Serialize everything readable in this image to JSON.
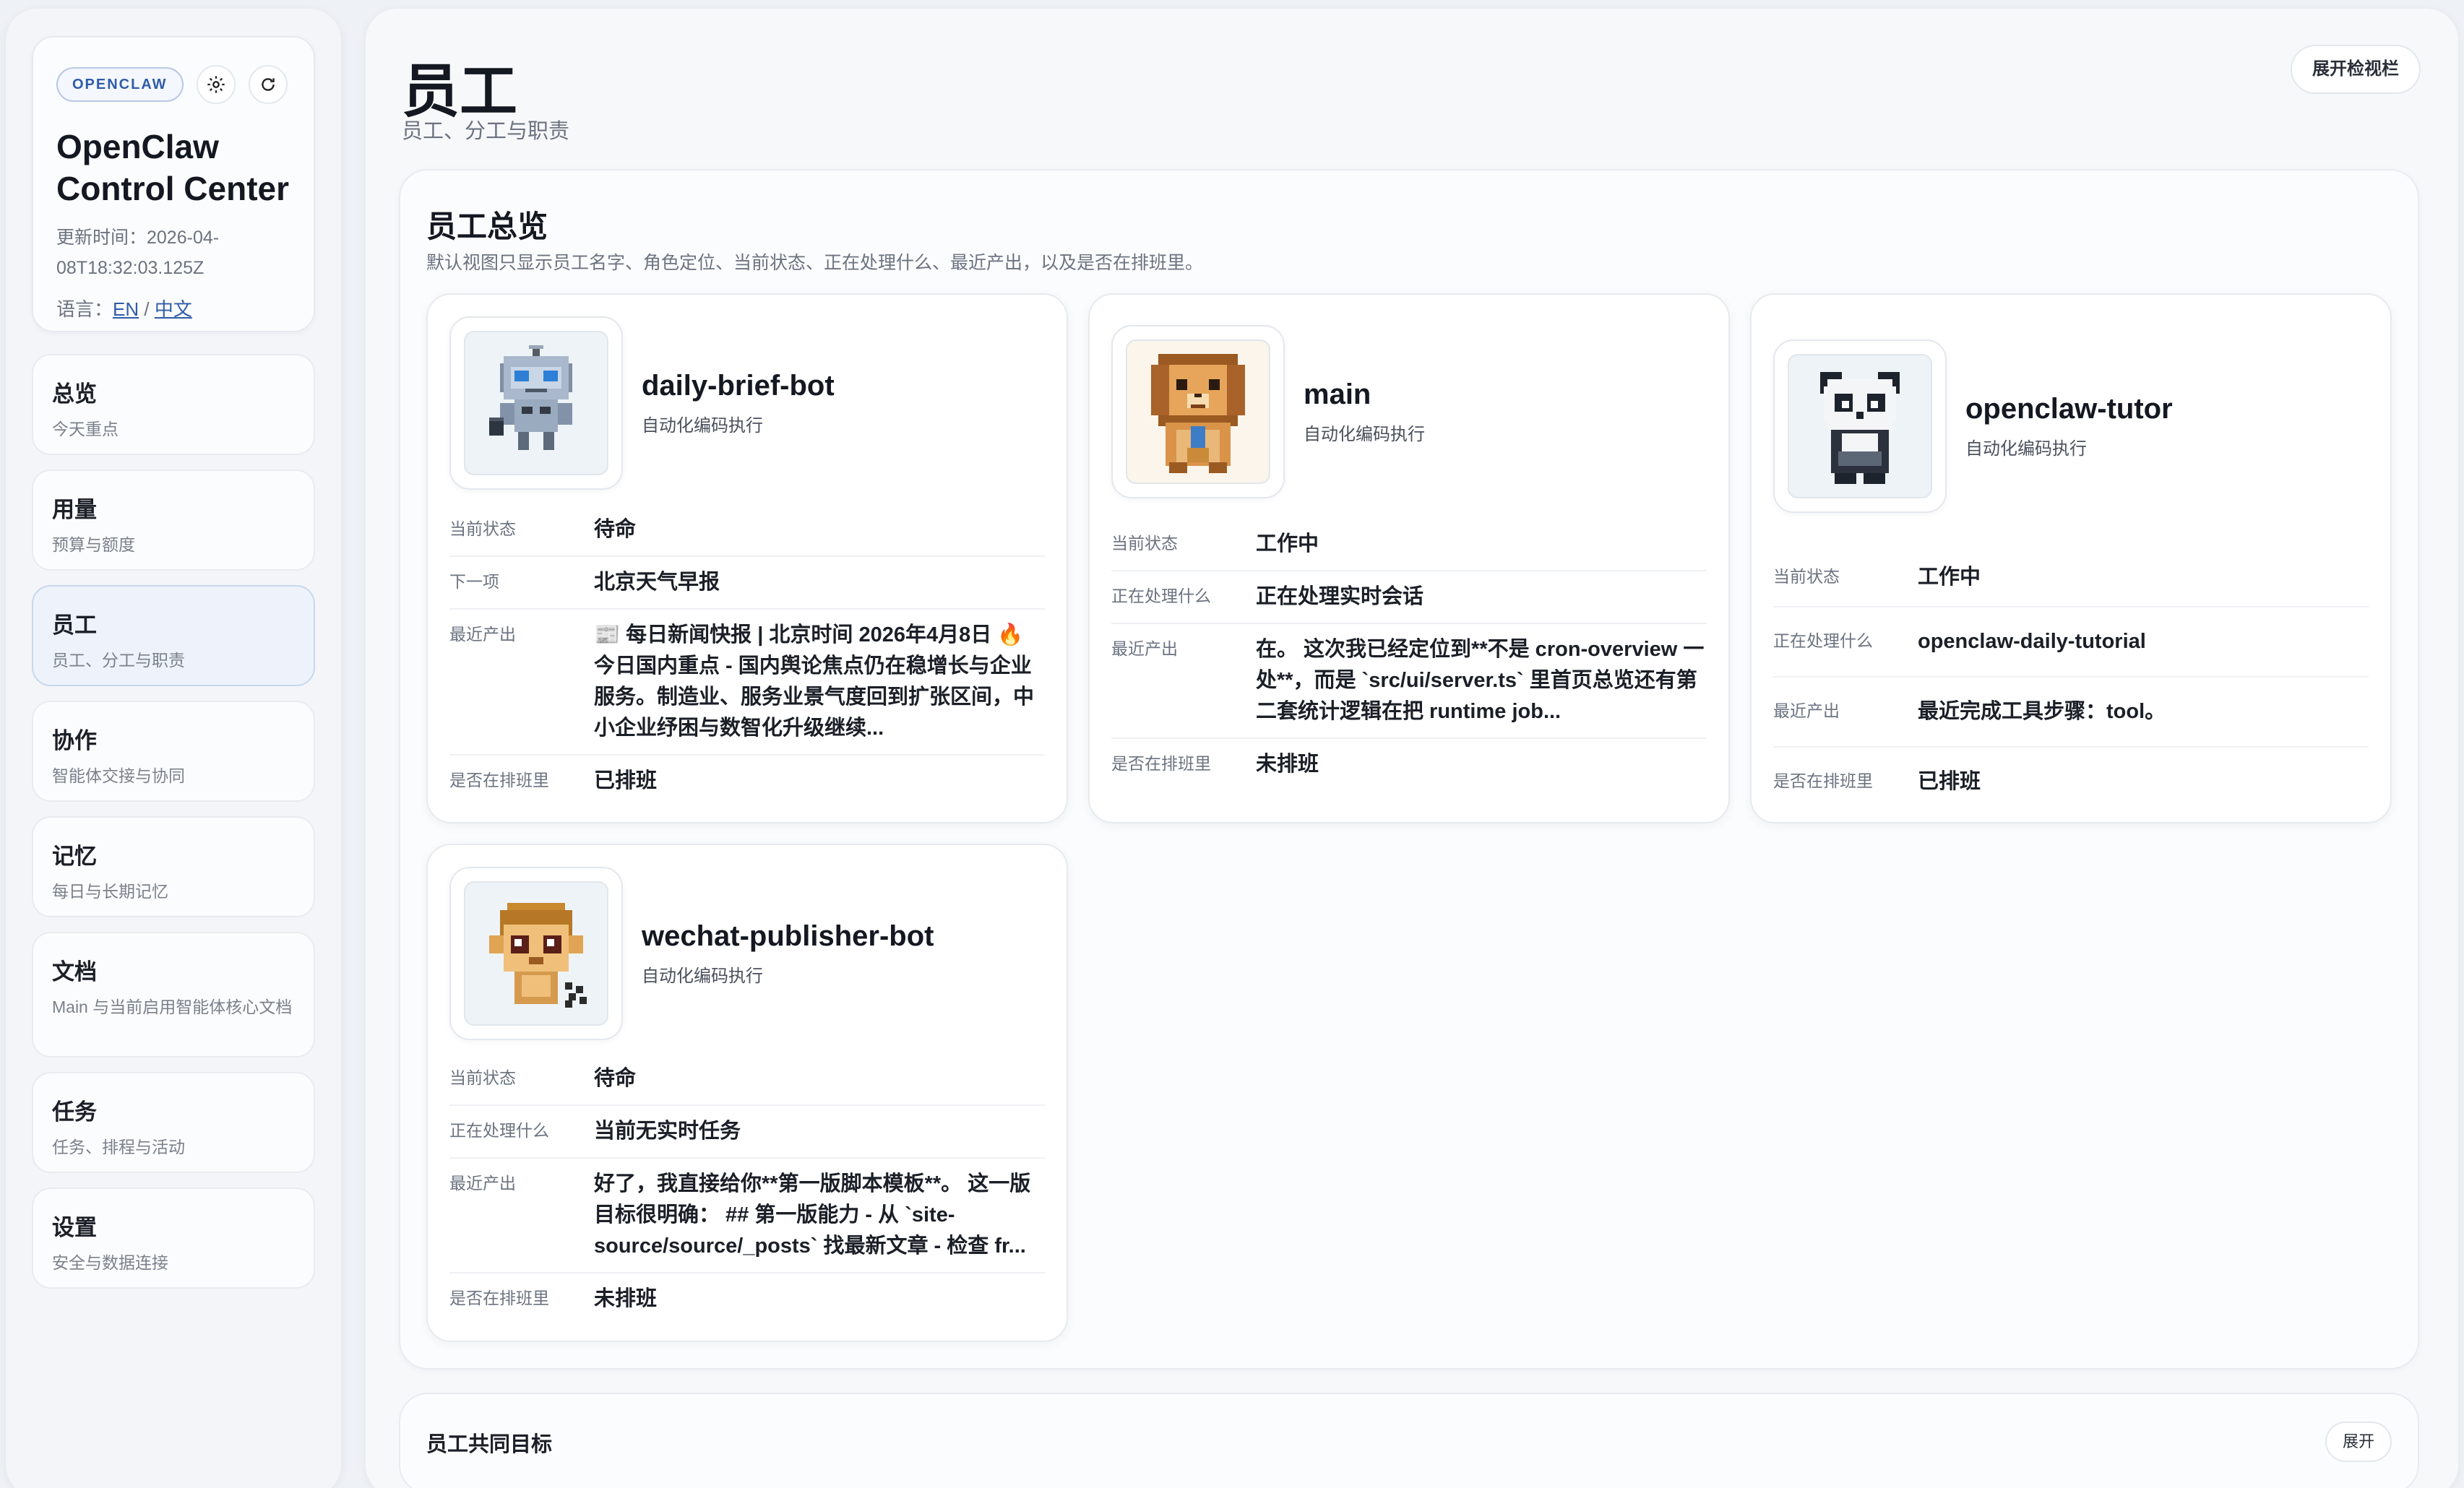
{
  "sidebar": {
    "badge": "OPENCLAW",
    "title": "OpenClaw Control Center",
    "updated": "更新时间：2026-04-08T18:32:03.125Z",
    "lang_label": "语言：",
    "lang_en": "EN",
    "lang_sep": " / ",
    "lang_zh": "中文",
    "items": [
      {
        "label": "总览",
        "sub": "今天重点"
      },
      {
        "label": "用量",
        "sub": "预算与额度"
      },
      {
        "label": "员工",
        "sub": "员工、分工与职责"
      },
      {
        "label": "协作",
        "sub": "智能体交接与协同"
      },
      {
        "label": "记忆",
        "sub": "每日与长期记忆"
      },
      {
        "label": "文档",
        "sub": "Main 与当前启用智能体核心文档"
      },
      {
        "label": "任务",
        "sub": "任务、排程与活动"
      },
      {
        "label": "设置",
        "sub": "安全与数据连接"
      }
    ]
  },
  "header": {
    "title": "员工",
    "subtitle": "员工、分工与职责",
    "inspector_button": "展开检视栏"
  },
  "overview": {
    "title": "员工总览",
    "desc": "默认视图只显示员工名字、角色定位、当前状态、正在处理什么、最近产出，以及是否在排班里。"
  },
  "agents": [
    {
      "name": "daily-brief-bot",
      "role": "自动化编码执行",
      "rows": [
        {
          "label": "当前状态",
          "value": "待命"
        },
        {
          "label": "下一项",
          "value": "北京天气早报"
        },
        {
          "label": "最近产出",
          "value": "📰 每日新闻快报 | 北京时间 2026年4月8日 🔥 今日国内重点 - 国内舆论焦点仍在稳增长与企业服务。制造业、服务业景气度回到扩张区间，中小企业纾困与数智化升级继续..."
        },
        {
          "label": "是否在排班里",
          "value": "已排班"
        }
      ]
    },
    {
      "name": "main",
      "role": "自动化编码执行",
      "rows": [
        {
          "label": "当前状态",
          "value": "工作中"
        },
        {
          "label": "正在处理什么",
          "value": "正在处理实时会话"
        },
        {
          "label": "最近产出",
          "value": "在。 这次我已经定位到**不是 cron-overview 一处**，而是 `src/ui/server.ts` 里首页总览还有第二套统计逻辑在把 runtime job..."
        },
        {
          "label": "是否在排班里",
          "value": "未排班"
        }
      ]
    },
    {
      "name": "openclaw-tutor",
      "role": "自动化编码执行",
      "rows": [
        {
          "label": "当前状态",
          "value": "工作中"
        },
        {
          "label": "正在处理什么",
          "value": "openclaw-daily-tutorial"
        },
        {
          "label": "最近产出",
          "value": "最近完成工具步骤：tool。"
        },
        {
          "label": "是否在排班里",
          "value": "已排班"
        }
      ]
    },
    {
      "name": "wechat-publisher-bot",
      "role": "自动化编码执行",
      "rows": [
        {
          "label": "当前状态",
          "value": "待命"
        },
        {
          "label": "正在处理什么",
          "value": "当前无实时任务"
        },
        {
          "label": "最近产出",
          "value": "好了，我直接给你**第一版脚本模板**。 这一版目标很明确： ## 第一版能力 - 从 `site-source/source/_posts` 找最新文章 - 检查 fr..."
        },
        {
          "label": "是否在排班里",
          "value": "未排班"
        }
      ]
    }
  ],
  "goals": {
    "title": "员工共同目标",
    "button": "展开"
  }
}
